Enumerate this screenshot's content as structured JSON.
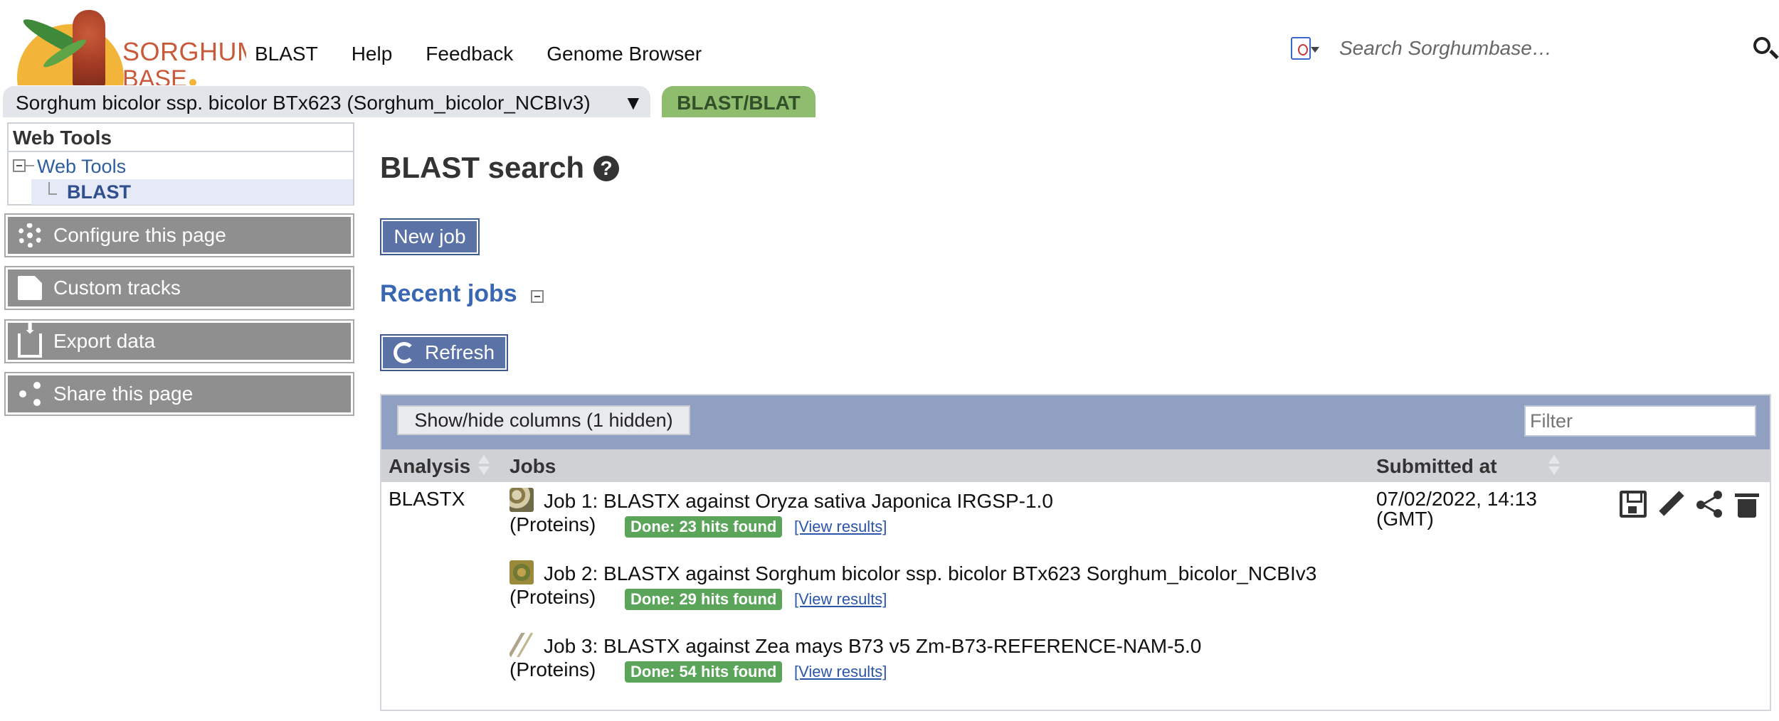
{
  "header": {
    "brand_line1": "SORGHUM",
    "brand_line2": "BASE",
    "nav": [
      "BLAST",
      "Help",
      "Feedback",
      "Genome Browser"
    ],
    "search_placeholder": "Search Sorghumbase…"
  },
  "species_bar": {
    "species_label": "Sorghum bicolor ssp. bicolor BTx623 (Sorghum_bicolor_NCBIv3)",
    "dropdown_arrow": "▼",
    "active_tab": "BLAST/BLAT"
  },
  "sidebar": {
    "tree_title": "Web Tools",
    "tree_parent": "Web Tools",
    "tree_child": "BLAST",
    "buttons": [
      {
        "label": "Configure this page",
        "icon": "gear-icon"
      },
      {
        "label": "Custom tracks",
        "icon": "custom-tracks-icon"
      },
      {
        "label": "Export data",
        "icon": "export-icon"
      },
      {
        "label": "Share this page",
        "icon": "share-icon"
      }
    ]
  },
  "main": {
    "title": "BLAST search",
    "help_glyph": "?",
    "new_job_label": "New job",
    "recent_jobs_title": "Recent jobs",
    "refresh_label": "Refresh",
    "table": {
      "show_hide_label": "Show/hide columns (1 hidden)",
      "filter_placeholder": "Filter",
      "columns": [
        "Analysis",
        "Jobs",
        "Submitted at"
      ],
      "row": {
        "analysis": "BLASTX",
        "submitted": "07/02/2022, 14:13",
        "timezone": "(GMT)",
        "jobs": [
          {
            "title": "Job 1: BLASTX against Oryza sativa Japonica IRGSP-1.0",
            "type": "(Proteins)",
            "status": "Done: 23 hits found",
            "link": "[View results]"
          },
          {
            "title": "Job 2: BLASTX against Sorghum bicolor ssp. bicolor BTx623 Sorghum_bicolor_NCBIv3",
            "type": "(Proteins)",
            "status": "Done: 29 hits found",
            "link": "[View results]"
          },
          {
            "title": "Job 3: BLASTX against Zea mays B73 v5 Zm-B73-REFERENCE-NAM-5.0",
            "type": "(Proteins)",
            "status": "Done: 54 hits found",
            "link": "[View results]"
          }
        ]
      }
    }
  },
  "colors": {
    "brand": "#c85a3a",
    "tab_active": "#8fbd6e",
    "table_bar": "#8fa0c2",
    "button_blue": "#5a72a5",
    "status_green": "#5aa55a",
    "link": "#3a67b3"
  }
}
